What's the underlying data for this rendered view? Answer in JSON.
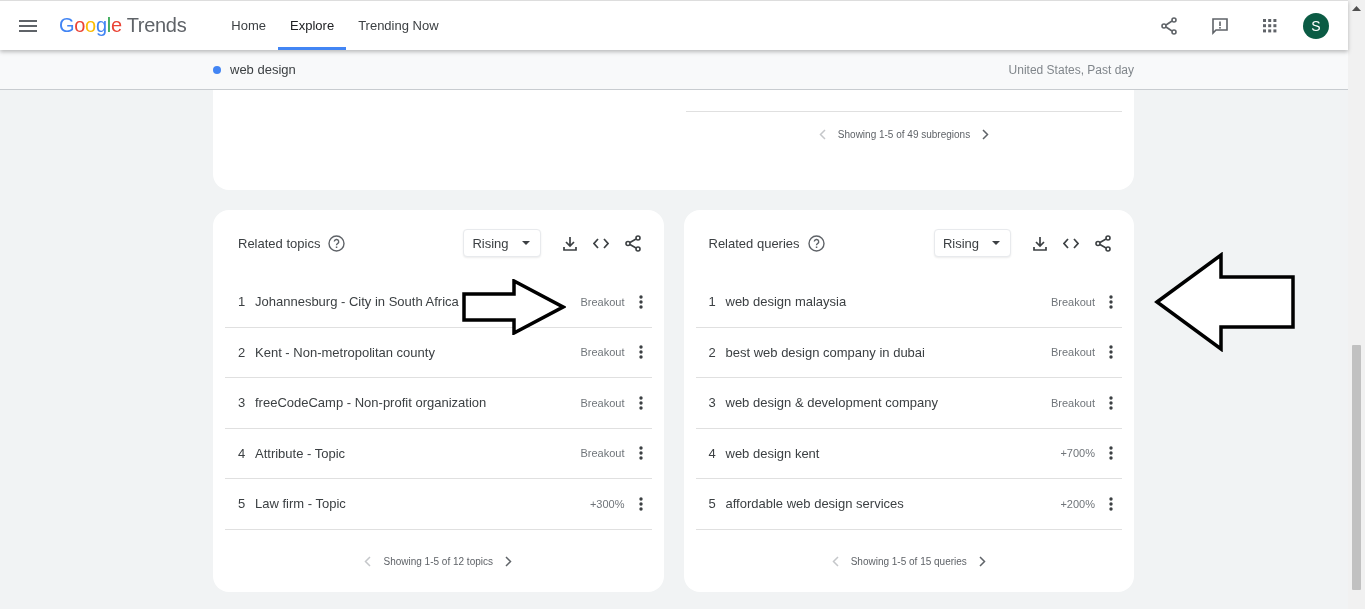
{
  "header": {
    "logo_brand": "Google",
    "logo_product": "Trends",
    "tabs": [
      {
        "label": "Home",
        "selected": false
      },
      {
        "label": "Explore",
        "selected": true
      },
      {
        "label": "Trending Now",
        "selected": false
      }
    ],
    "avatar_initial": "S"
  },
  "search_bar": {
    "terms": [
      {
        "label": "web design",
        "color": "#4285f4"
      }
    ],
    "scope": "United States, Past day"
  },
  "top_card": {
    "pagination": "Showing 1-5 of 49 subregions"
  },
  "panels": [
    {
      "title": "Related topics",
      "filter": "Rising",
      "pagination": "Showing 1-5 of 12 topics",
      "rows": [
        {
          "rank": "1",
          "label": "Johannesburg - City in South Africa",
          "value": "Breakout"
        },
        {
          "rank": "2",
          "label": "Kent - Non-metropolitan county",
          "value": "Breakout"
        },
        {
          "rank": "3",
          "label": "freeCodeCamp - Non-profit organization",
          "value": "Breakout"
        },
        {
          "rank": "4",
          "label": "Attribute - Topic",
          "value": "Breakout"
        },
        {
          "rank": "5",
          "label": "Law firm - Topic",
          "value": "+300%"
        }
      ]
    },
    {
      "title": "Related queries",
      "filter": "Rising",
      "pagination": "Showing 1-5 of 15 queries",
      "rows": [
        {
          "rank": "1",
          "label": "web design malaysia",
          "value": "Breakout"
        },
        {
          "rank": "2",
          "label": "best web design company in dubai",
          "value": "Breakout"
        },
        {
          "rank": "3",
          "label": "web design & development company",
          "value": "Breakout"
        },
        {
          "rank": "4",
          "label": "web design kent",
          "value": "+700%"
        },
        {
          "rank": "5",
          "label": "affordable web design services",
          "value": "+200%"
        }
      ]
    }
  ],
  "annotations": [
    {
      "kind": "arrow_right"
    },
    {
      "kind": "arrow_left"
    }
  ]
}
